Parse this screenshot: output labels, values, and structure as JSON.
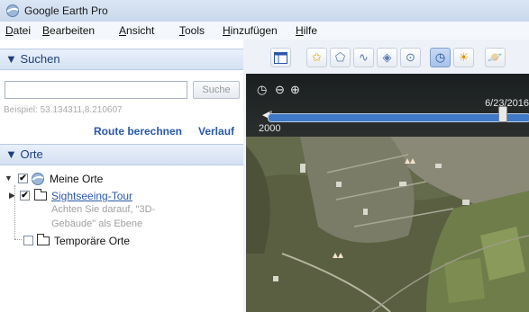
{
  "window": {
    "title": "Google Earth Pro"
  },
  "menu": [
    {
      "label": "Datei",
      "u": "D",
      "rest": "atei"
    },
    {
      "label": "Bearbeiten",
      "u": "B",
      "rest": "earbeiten"
    },
    {
      "label": "Ansicht",
      "u": "A",
      "rest": "nsicht"
    },
    {
      "label": "Tools",
      "u": "T",
      "rest": "ools"
    },
    {
      "label": "Hinzufügen",
      "u": "H",
      "rest": "inzufügen"
    },
    {
      "label": "Hilfe",
      "u": "H",
      "rest": "ilfe"
    }
  ],
  "search": {
    "header": "▼ Suchen",
    "input_value": "",
    "placeholder": "",
    "button": "Suche",
    "example": "Beispiel: 53.134311,8.210607",
    "route_link": "Route berechnen",
    "history_link": "Verlauf"
  },
  "places": {
    "header": "▼ Orte",
    "my_places": "Meine Orte",
    "tour": "Sightseeing-Tour",
    "note_line1": "Achten Sie darauf, \"3D-",
    "note_line2": "Gebäude\" als Ebene",
    "temp_places": "Temporäre Orte"
  },
  "timeline": {
    "date": "6/23/2016",
    "start_year": "2000"
  },
  "colors": {
    "accent": "#2a58a8",
    "header_bg": "#d4e1f2",
    "timeline_track": "#3f79c8"
  },
  "icons": [
    "sidebar-toggle-icon",
    "placemark-icon",
    "polygon-icon",
    "path-icon",
    "overlay-icon",
    "record-tour-icon",
    "historical-imagery-icon",
    "sun-icon",
    "planet-icon"
  ]
}
